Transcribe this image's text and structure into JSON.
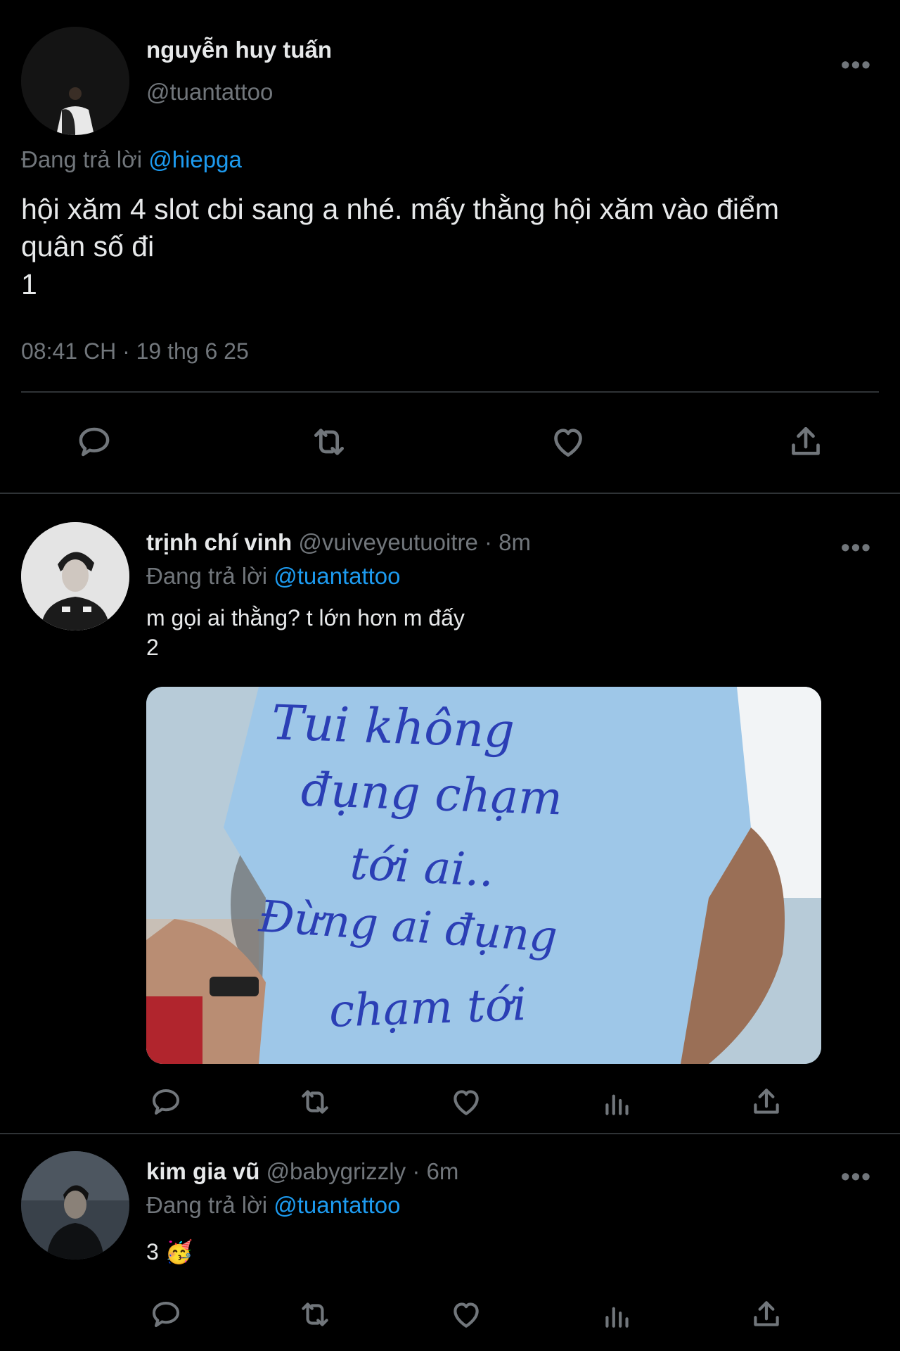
{
  "main_tweet": {
    "display_name": "nguyễn huy tuấn",
    "handle": "@tuantattoo",
    "replying_prefix": "Đang trả lời",
    "replying_to": "@hiepga",
    "text_line1": "hội xăm 4 slot cbi sang a nhé. mấy thằng hội xăm vào điểm",
    "text_line2": "quân số đi",
    "text_line3": "1",
    "timestamp": "08:41 CH · 19 thg 6 25",
    "more": "•••"
  },
  "reply1": {
    "display_name": "trịnh chí vinh",
    "handle": "@vuiveyeutuoitre",
    "time": "· 8m",
    "replying_prefix": "Đang trả lời",
    "replying_to": "@tuantattoo",
    "text_line1": "m gọi ai thằng? t lớn hơn m đấy",
    "text_line2": "2",
    "more": "•••",
    "media": {
      "shirt_line1": "Tui không",
      "shirt_line2": "đụng chạm",
      "shirt_line3": "tới ai..",
      "shirt_line4": "Đừng ai đụng",
      "shirt_line5": "chạm tới"
    }
  },
  "reply2": {
    "display_name": "kim gia vũ",
    "handle": "@babygrizzly",
    "time": "· 6m",
    "replying_prefix": "Đang trả lời",
    "replying_to": "@tuantattoo",
    "text": "3",
    "emoji": "🥳",
    "more": "•••"
  },
  "colors": {
    "background": "#000000",
    "text": "#e7e9ea",
    "muted": "#71767b",
    "link": "#1d9bf0",
    "divider": "#2f3336",
    "shirt": "#9ec7e8",
    "ink": "#2b3fb5"
  },
  "icons": [
    "reply-icon",
    "retweet-icon",
    "like-icon",
    "views-icon",
    "share-icon",
    "more-icon"
  ]
}
